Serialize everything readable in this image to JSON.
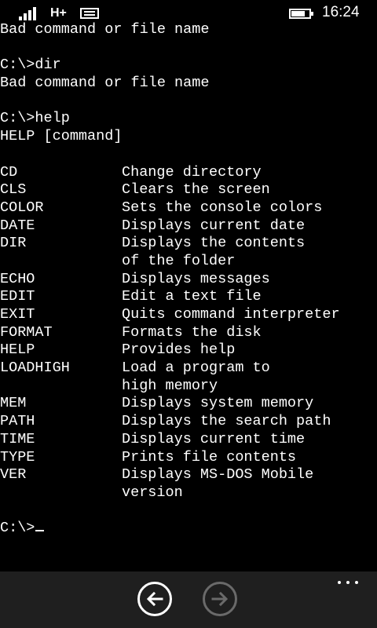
{
  "status_bar": {
    "network": "H+",
    "time": "16:24",
    "battery_level": 0.75
  },
  "terminal": {
    "pre_lines": [
      "Bad command or file name",
      "",
      "C:\\>dir",
      "Bad command or file name",
      "",
      "C:\\>help",
      "HELP [command]",
      ""
    ],
    "help_entries": [
      {
        "cmd": "CD",
        "desc": "Change directory"
      },
      {
        "cmd": "CLS",
        "desc": "Clears the screen"
      },
      {
        "cmd": "COLOR",
        "desc": "Sets the console colors"
      },
      {
        "cmd": "DATE",
        "desc": "Displays current date"
      },
      {
        "cmd": "DIR",
        "desc": "Displays the contents"
      },
      {
        "cmd": "",
        "desc": "of the folder"
      },
      {
        "cmd": "ECHO",
        "desc": "Displays messages"
      },
      {
        "cmd": "EDIT",
        "desc": "Edit a text file"
      },
      {
        "cmd": "EXIT",
        "desc": "Quits command interpreter"
      },
      {
        "cmd": "FORMAT",
        "desc": "Formats the disk"
      },
      {
        "cmd": "HELP",
        "desc": "Provides help"
      },
      {
        "cmd": "LOADHIGH",
        "desc": "Load a program to"
      },
      {
        "cmd": "",
        "desc": "high memory"
      },
      {
        "cmd": "MEM",
        "desc": "Displays system memory"
      },
      {
        "cmd": "PATH",
        "desc": "Displays the search path"
      },
      {
        "cmd": "TIME",
        "desc": "Displays current time"
      },
      {
        "cmd": "TYPE",
        "desc": "Prints file contents"
      },
      {
        "cmd": "VER",
        "desc": "Displays MS-DOS Mobile"
      },
      {
        "cmd": "",
        "desc": "version"
      }
    ],
    "prompt": "C:\\>"
  },
  "app_bar": {
    "back_icon": "back-arrow-icon",
    "forward_icon": "forward-arrow-icon",
    "more_icon": "ellipsis-icon"
  }
}
